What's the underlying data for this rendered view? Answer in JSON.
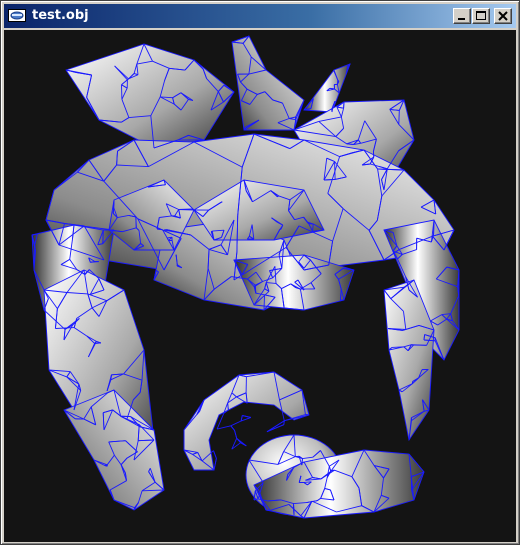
{
  "window": {
    "title": "test.obj",
    "icon": "app-icon",
    "controls": [
      {
        "name": "minimize-button",
        "icon": "minimize-icon"
      },
      {
        "name": "maximize-button",
        "icon": "maximize-icon"
      },
      {
        "name": "close-button",
        "icon": "close-icon"
      }
    ]
  },
  "viewport": {
    "background": "#141414",
    "wireframe_color": "#1a1aff",
    "surface_colors": [
      "#ffffff",
      "#8a8a8a",
      "#2a2a2a"
    ]
  }
}
